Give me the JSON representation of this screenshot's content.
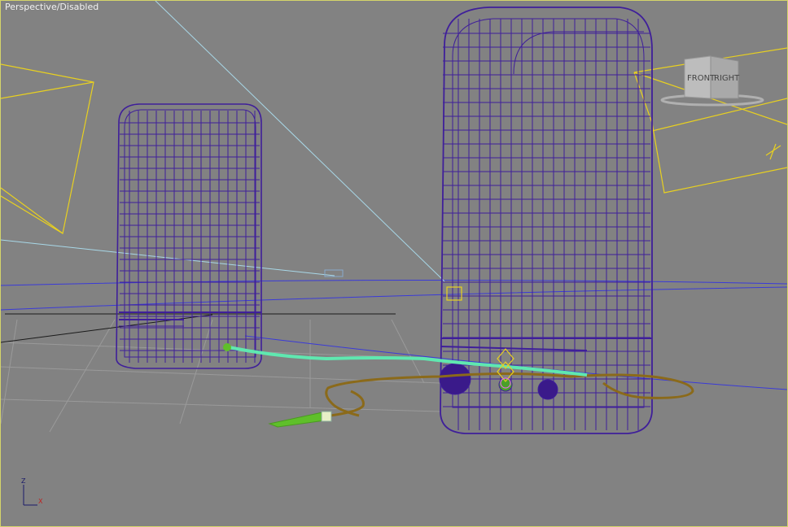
{
  "viewport": {
    "label": "Perspective/Disabled",
    "view_cube": {
      "front": "FRONT",
      "right": "RIGHT"
    },
    "axis_tripod": {
      "z": "Z",
      "x": "X"
    }
  },
  "colors": {
    "background": "#828282",
    "speaker_wireframe": "#3f1f9a",
    "camera_frustum": "#e8d020",
    "cable_brown": "#8b6a1a",
    "connector_green": "#5fbf2a",
    "cable_cyan": "#5fe8b0",
    "ground_line": "#3a3ad8"
  },
  "scene_objects": [
    "left-speaker",
    "right-speaker",
    "audio-cable",
    "camera"
  ]
}
